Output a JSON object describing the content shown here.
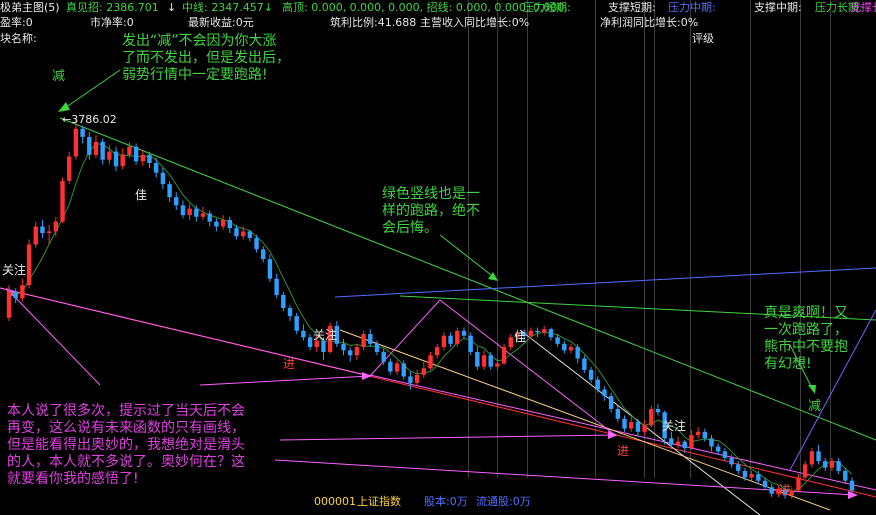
{
  "header": {
    "row1": [
      {
        "text": "极弟主图(5)",
        "color": "#e8e8e8"
      },
      {
        "text": "真见招: 2386.701",
        "color": "#3fd43f"
      },
      {
        "text": "↓",
        "color": "#e8e8e8"
      },
      {
        "text": "中线: 2347.457↓",
        "color": "#3fd43f"
      },
      {
        "text": "高顶: 0.000, 0.000, 0.000, 招线: 0.000, 0.000, 0.000,",
        "color": "#3fd43f"
      },
      {
        "text": "压力短期:",
        "color": "#3fd43f"
      },
      {
        "text": "支撑短期:",
        "color": "#e8e8e8"
      },
      {
        "text": "压力中期:",
        "color": "#4f6fff"
      },
      {
        "text": "支撑中期:",
        "color": "#e8e8e8"
      },
      {
        "text": "压力长期:",
        "color": "#3fd43f"
      },
      {
        "text": "支撑长期:",
        "color": "#ff3fff"
      }
    ],
    "row2": [
      "盈率:0",
      "市净率:0",
      "最新收益:0元",
      "筑利比例:41.688",
      "主营收入同比增长:0%",
      "净利润同比增长:0%"
    ],
    "row3": [
      "块名称:",
      "评级"
    ]
  },
  "chart_data": {
    "type": "candlestick",
    "peak_label": "←3786.02",
    "candles": [
      {
        "o": 2560,
        "c": 2720,
        "h": 2760,
        "l": 2540
      },
      {
        "o": 2720,
        "c": 2680,
        "h": 2740,
        "l": 2650
      },
      {
        "o": 2680,
        "c": 2760,
        "h": 2800,
        "l": 2660
      },
      {
        "o": 2760,
        "c": 3010,
        "h": 3040,
        "l": 2740
      },
      {
        "o": 3010,
        "c": 3120,
        "h": 3150,
        "l": 2990
      },
      {
        "o": 3120,
        "c": 3080,
        "h": 3160,
        "l": 3050
      },
      {
        "o": 3080,
        "c": 3090,
        "h": 3130,
        "l": 3010
      },
      {
        "o": 3090,
        "c": 3150,
        "h": 3180,
        "l": 3060
      },
      {
        "o": 3150,
        "c": 3400,
        "h": 3420,
        "l": 3140
      },
      {
        "o": 3400,
        "c": 3550,
        "h": 3580,
        "l": 3380
      },
      {
        "o": 3550,
        "c": 3720,
        "h": 3786,
        "l": 3530
      },
      {
        "o": 3720,
        "c": 3670,
        "h": 3740,
        "l": 3630
      },
      {
        "o": 3670,
        "c": 3560,
        "h": 3700,
        "l": 3530
      },
      {
        "o": 3560,
        "c": 3640,
        "h": 3680,
        "l": 3540
      },
      {
        "o": 3640,
        "c": 3530,
        "h": 3660,
        "l": 3500
      },
      {
        "o": 3530,
        "c": 3580,
        "h": 3620,
        "l": 3500
      },
      {
        "o": 3580,
        "c": 3490,
        "h": 3610,
        "l": 3460
      },
      {
        "o": 3490,
        "c": 3560,
        "h": 3600,
        "l": 3470
      },
      {
        "o": 3560,
        "c": 3610,
        "h": 3640,
        "l": 3540
      },
      {
        "o": 3610,
        "c": 3520,
        "h": 3630,
        "l": 3500
      },
      {
        "o": 3520,
        "c": 3560,
        "h": 3590,
        "l": 3490
      },
      {
        "o": 3560,
        "c": 3510,
        "h": 3580,
        "l": 3480
      },
      {
        "o": 3510,
        "c": 3450,
        "h": 3540,
        "l": 3420
      },
      {
        "o": 3450,
        "c": 3380,
        "h": 3480,
        "l": 3350
      },
      {
        "o": 3380,
        "c": 3300,
        "h": 3400,
        "l": 3270
      },
      {
        "o": 3300,
        "c": 3250,
        "h": 3330,
        "l": 3220
      },
      {
        "o": 3250,
        "c": 3190,
        "h": 3280,
        "l": 3170
      },
      {
        "o": 3190,
        "c": 3230,
        "h": 3260,
        "l": 3160
      },
      {
        "o": 3230,
        "c": 3180,
        "h": 3250,
        "l": 3150
      },
      {
        "o": 3180,
        "c": 3200,
        "h": 3240,
        "l": 3160
      },
      {
        "o": 3200,
        "c": 3150,
        "h": 3220,
        "l": 3120
      },
      {
        "o": 3150,
        "c": 3120,
        "h": 3170,
        "l": 3090
      },
      {
        "o": 3120,
        "c": 3160,
        "h": 3190,
        "l": 3100
      },
      {
        "o": 3160,
        "c": 3110,
        "h": 3180,
        "l": 3080
      },
      {
        "o": 3110,
        "c": 3060,
        "h": 3130,
        "l": 3040
      },
      {
        "o": 3060,
        "c": 3090,
        "h": 3120,
        "l": 3040
      },
      {
        "o": 3090,
        "c": 3050,
        "h": 3100,
        "l": 3030
      },
      {
        "o": 3050,
        "c": 2980,
        "h": 3070,
        "l": 2960
      },
      {
        "o": 2980,
        "c": 2920,
        "h": 3000,
        "l": 2900
      },
      {
        "o": 2920,
        "c": 2800,
        "h": 2950,
        "l": 2780
      },
      {
        "o": 2800,
        "c": 2700,
        "h": 2830,
        "l": 2680
      },
      {
        "o": 2700,
        "c": 2620,
        "h": 2720,
        "l": 2600
      },
      {
        "o": 2620,
        "c": 2570,
        "h": 2640,
        "l": 2540
      },
      {
        "o": 2570,
        "c": 2480,
        "h": 2590,
        "l": 2460
      },
      {
        "o": 2480,
        "c": 2440,
        "h": 2520,
        "l": 2420
      },
      {
        "o": 2440,
        "c": 2380,
        "h": 2460,
        "l": 2360
      },
      {
        "o": 2380,
        "c": 2420,
        "h": 2450,
        "l": 2350
      },
      {
        "o": 2420,
        "c": 2350,
        "h": 2440,
        "l": 2300
      },
      {
        "o": 2350,
        "c": 2510,
        "h": 2530,
        "l": 2340
      },
      {
        "o": 2510,
        "c": 2400,
        "h": 2540,
        "l": 2380
      },
      {
        "o": 2400,
        "c": 2360,
        "h": 2430,
        "l": 2330
      },
      {
        "o": 2360,
        "c": 2330,
        "h": 2380,
        "l": 2290
      },
      {
        "o": 2330,
        "c": 2380,
        "h": 2400,
        "l": 2300
      },
      {
        "o": 2380,
        "c": 2460,
        "h": 2480,
        "l": 2360
      },
      {
        "o": 2460,
        "c": 2400,
        "h": 2490,
        "l": 2380
      },
      {
        "o": 2400,
        "c": 2350,
        "h": 2420,
        "l": 2330
      },
      {
        "o": 2350,
        "c": 2290,
        "h": 2370,
        "l": 2270
      },
      {
        "o": 2290,
        "c": 2230,
        "h": 2310,
        "l": 2210
      },
      {
        "o": 2230,
        "c": 2280,
        "h": 2300,
        "l": 2210
      },
      {
        "o": 2280,
        "c": 2200,
        "h": 2300,
        "l": 2180
      },
      {
        "o": 2200,
        "c": 2160,
        "h": 2230,
        "l": 2120
      },
      {
        "o": 2160,
        "c": 2210,
        "h": 2240,
        "l": 2140
      },
      {
        "o": 2210,
        "c": 2250,
        "h": 2290,
        "l": 2190
      },
      {
        "o": 2250,
        "c": 2330,
        "h": 2350,
        "l": 2240
      },
      {
        "o": 2330,
        "c": 2380,
        "h": 2400,
        "l": 2310
      },
      {
        "o": 2380,
        "c": 2450,
        "h": 2470,
        "l": 2360
      },
      {
        "o": 2450,
        "c": 2400,
        "h": 2470,
        "l": 2380
      },
      {
        "o": 2400,
        "c": 2480,
        "h": 2500,
        "l": 2380
      },
      {
        "o": 2480,
        "c": 2450,
        "h": 2500,
        "l": 2430
      },
      {
        "o": 2450,
        "c": 2350,
        "h": 2470,
        "l": 2330
      },
      {
        "o": 2350,
        "c": 2260,
        "h": 2380,
        "l": 2240
      },
      {
        "o": 2260,
        "c": 2330,
        "h": 2360,
        "l": 2240
      },
      {
        "o": 2330,
        "c": 2260,
        "h": 2350,
        "l": 2240
      },
      {
        "o": 2260,
        "c": 2280,
        "h": 2310,
        "l": 2240
      },
      {
        "o": 2280,
        "c": 2380,
        "h": 2400,
        "l": 2270
      },
      {
        "o": 2380,
        "c": 2440,
        "h": 2460,
        "l": 2360
      },
      {
        "o": 2440,
        "c": 2470,
        "h": 2490,
        "l": 2420
      },
      {
        "o": 2470,
        "c": 2450,
        "h": 2490,
        "l": 2420
      },
      {
        "o": 2450,
        "c": 2480,
        "h": 2500,
        "l": 2430
      },
      {
        "o": 2480,
        "c": 2470,
        "h": 2500,
        "l": 2440
      },
      {
        "o": 2470,
        "c": 2490,
        "h": 2510,
        "l": 2450
      },
      {
        "o": 2490,
        "c": 2440,
        "h": 2500,
        "l": 2420
      },
      {
        "o": 2440,
        "c": 2400,
        "h": 2460,
        "l": 2380
      },
      {
        "o": 2400,
        "c": 2360,
        "h": 2420,
        "l": 2340
      },
      {
        "o": 2360,
        "c": 2380,
        "h": 2400,
        "l": 2340
      },
      {
        "o": 2380,
        "c": 2310,
        "h": 2400,
        "l": 2280
      },
      {
        "o": 2310,
        "c": 2240,
        "h": 2330,
        "l": 2220
      },
      {
        "o": 2240,
        "c": 2180,
        "h": 2260,
        "l": 2160
      },
      {
        "o": 2180,
        "c": 2120,
        "h": 2200,
        "l": 2100
      },
      {
        "o": 2120,
        "c": 2080,
        "h": 2140,
        "l": 2050
      },
      {
        "o": 2080,
        "c": 2000,
        "h": 2100,
        "l": 1980
      },
      {
        "o": 2000,
        "c": 1940,
        "h": 2020,
        "l": 1920
      },
      {
        "o": 1940,
        "c": 1880,
        "h": 1960,
        "l": 1860
      },
      {
        "o": 1880,
        "c": 1920,
        "h": 1950,
        "l": 1860
      },
      {
        "o": 1920,
        "c": 1860,
        "h": 1940,
        "l": 1830
      },
      {
        "o": 1860,
        "c": 1900,
        "h": 1930,
        "l": 1840
      },
      {
        "o": 1900,
        "c": 2000,
        "h": 2020,
        "l": 1890
      },
      {
        "o": 2000,
        "c": 1980,
        "h": 2030,
        "l": 1960
      },
      {
        "o": 1980,
        "c": 1820,
        "h": 1990,
        "l": 1780
      },
      {
        "o": 1820,
        "c": 1780,
        "h": 1860,
        "l": 1760
      },
      {
        "o": 1780,
        "c": 1800,
        "h": 1830,
        "l": 1760
      },
      {
        "o": 1800,
        "c": 1760,
        "h": 1810,
        "l": 1730
      },
      {
        "o": 1760,
        "c": 1840,
        "h": 1870,
        "l": 1750
      },
      {
        "o": 1840,
        "c": 1860,
        "h": 1890,
        "l": 1820
      },
      {
        "o": 1860,
        "c": 1820,
        "h": 1880,
        "l": 1800
      },
      {
        "o": 1820,
        "c": 1770,
        "h": 1840,
        "l": 1740
      },
      {
        "o": 1770,
        "c": 1740,
        "h": 1790,
        "l": 1720
      },
      {
        "o": 1740,
        "c": 1700,
        "h": 1760,
        "l": 1680
      },
      {
        "o": 1700,
        "c": 1660,
        "h": 1720,
        "l": 1640
      },
      {
        "o": 1660,
        "c": 1620,
        "h": 1680,
        "l": 1600
      },
      {
        "o": 1620,
        "c": 1580,
        "h": 1640,
        "l": 1560
      },
      {
        "o": 1580,
        "c": 1600,
        "h": 1620,
        "l": 1560
      },
      {
        "o": 1600,
        "c": 1560,
        "h": 1620,
        "l": 1540
      },
      {
        "o": 1560,
        "c": 1520,
        "h": 1580,
        "l": 1500
      },
      {
        "o": 1520,
        "c": 1480,
        "h": 1540,
        "l": 1460
      },
      {
        "o": 1480,
        "c": 1510,
        "h": 1530,
        "l": 1460
      },
      {
        "o": 1510,
        "c": 1470,
        "h": 1520,
        "l": 1450
      },
      {
        "o": 1470,
        "c": 1500,
        "h": 1520,
        "l": 1450
      },
      {
        "o": 1500,
        "c": 1580,
        "h": 1600,
        "l": 1490
      },
      {
        "o": 1580,
        "c": 1660,
        "h": 1680,
        "l": 1570
      },
      {
        "o": 1660,
        "c": 1740,
        "h": 1760,
        "l": 1640
      },
      {
        "o": 1740,
        "c": 1680,
        "h": 1780,
        "l": 1660
      },
      {
        "o": 1680,
        "c": 1640,
        "h": 1700,
        "l": 1620
      },
      {
        "o": 1640,
        "c": 1680,
        "h": 1700,
        "l": 1620
      },
      {
        "o": 1680,
        "c": 1620,
        "h": 1700,
        "l": 1600
      },
      {
        "o": 1620,
        "c": 1560,
        "h": 1640,
        "l": 1540
      },
      {
        "o": 1560,
        "c": 1500,
        "h": 1580,
        "l": 1480
      }
    ]
  },
  "annotations": [
    {
      "text": "发出“减”不会因为你大涨\n了而不发出，但是发出后，\n弱势行情中一定要跑路!",
      "color": "#3fd43f"
    },
    {
      "text": "减",
      "color": "#3fd43f"
    },
    {
      "text": "绿色竖线也是一\n样的跑路，绝不\n会后悔。",
      "color": "#3fd43f"
    },
    {
      "text": "真是爽啊！又\n一次跑路了，\n熊市中不要抱\n有幻想!",
      "color": "#3fd43f"
    },
    {
      "text": "减",
      "color": "#3fd43f"
    },
    {
      "text": "本人说了很多次，提示过了当天后不会\n再变，这么说有未来函数的只有画线，\n但是能看得出奥妙的，我想绝对是滑头\n的人，本人就不多说了。奥妙何在？这\n就要看你我的感悟了!",
      "color": "#e040e0"
    }
  ],
  "markers": [
    {
      "text": "关注",
      "color": "#e8e8e8"
    },
    {
      "text": "佳",
      "color": "#e8e8e8"
    },
    {
      "text": "关注",
      "color": "#e8e8e8"
    },
    {
      "text": "进",
      "color": "#ff4040"
    },
    {
      "text": "佳",
      "color": "#e8e8e8"
    },
    {
      "text": "关注",
      "color": "#e8e8e8"
    },
    {
      "text": "进",
      "color": "#ff4040"
    },
    {
      "text": "进",
      "color": "#ff4040"
    }
  ],
  "footer": {
    "code": "000001",
    "name": "上证指数",
    "share": "股本:0万",
    "float": "流通股:0万"
  },
  "colors": {
    "up": "#ff3030",
    "down": "#30a0ff",
    "pink": "#ff9ef0"
  }
}
